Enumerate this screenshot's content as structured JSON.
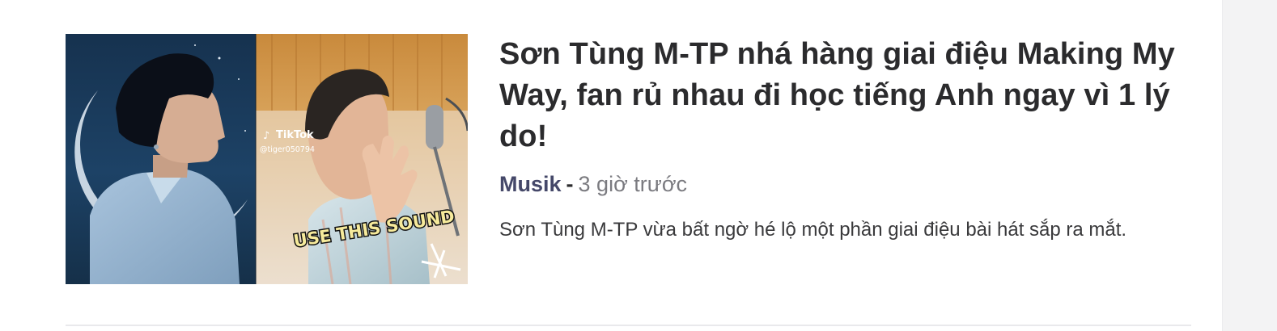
{
  "article": {
    "title": "Sơn Tùng M-TP nhá hàng giai điệu Making My Way, fan rủ nhau đi học tiếng Anh ngay vì 1 lý do!",
    "source": "Musik",
    "separator": "-",
    "time": "3 giờ trước",
    "summary": "Sơn Tùng M-TP vừa bất ngờ hé lộ một phần giai điệu bài hát sắp ra mắt.",
    "thumbnail": {
      "tiktok_label": "TikTok",
      "tiktok_handle": "@tiger050794",
      "caption": "USE THIS SOUND"
    }
  },
  "colors": {
    "title": "#2b2b2d",
    "source": "#454869",
    "time": "#7b7b80",
    "summary": "#3a3a3c",
    "divider": "#e9e9ec"
  }
}
